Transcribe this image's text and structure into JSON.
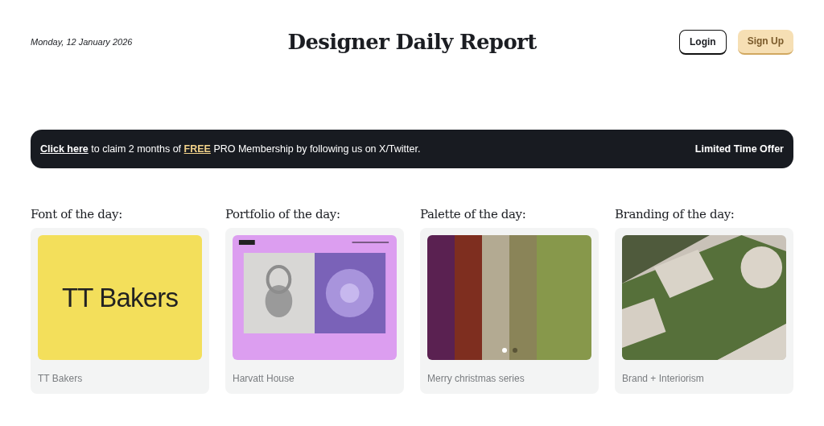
{
  "header": {
    "date": "Monday, 12 January 2026",
    "title": "Designer Daily Report",
    "buttons": [
      {
        "label": "Login",
        "kind": "outline"
      },
      {
        "label": "Sign Up",
        "kind": "accent"
      }
    ]
  },
  "banner": {
    "link": "Click here",
    "text_before": " to claim 2 months of ",
    "highlight": "FREE",
    "text_after": " PRO Membership by following us on X/Twitter.",
    "badge": "Limited Time Offer"
  },
  "cards": [
    {
      "heading": "Font of the day:",
      "kind": "font",
      "specimen": "TT Bakers",
      "caption": "TT Bakers"
    },
    {
      "heading": "Portfolio of the day:",
      "kind": "picture",
      "caption": "Harvatt House"
    },
    {
      "heading": "Palette of the day:",
      "kind": "palette",
      "swatches": [
        {
          "color": "#5a2151"
        },
        {
          "color": "#7e2e1f"
        },
        {
          "color": "#b3aa92"
        },
        {
          "color": "#8a8458"
        },
        {
          "color": "#87984b"
        }
      ],
      "dots": [
        {
          "selected": true
        },
        {
          "selected": false
        }
      ],
      "caption": "Merry christmas series"
    },
    {
      "heading": "Branding of the day:",
      "kind": "picture",
      "caption": "Brand + Interiorism"
    }
  ]
}
